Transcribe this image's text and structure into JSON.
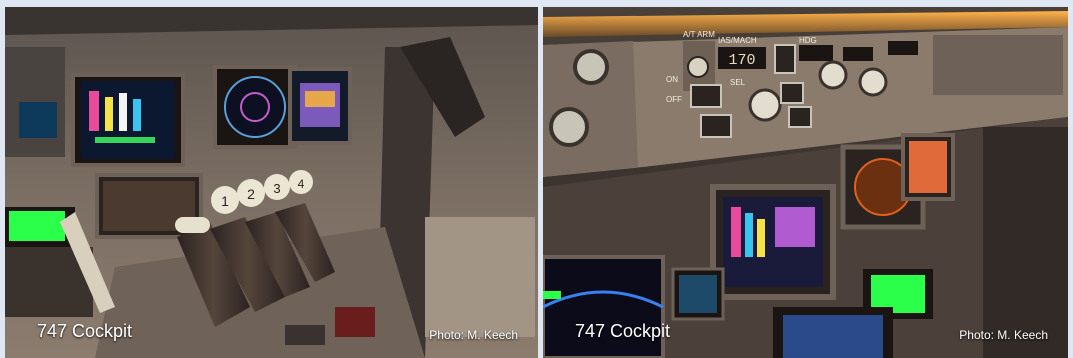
{
  "photos": [
    {
      "title": "747 Cockpit",
      "credit": "Photo: M. Keech"
    },
    {
      "title": "747 Cockpit",
      "credit": "Photo: M. Keech"
    }
  ],
  "lever_numbers": [
    "1",
    "2",
    "3",
    "4"
  ],
  "panel_readout": "170",
  "panel_labels": [
    "A/T ARM",
    "IAS/MACH",
    "HDG",
    "OFF",
    "ON",
    "SEL"
  ],
  "colors": {
    "page_background": "#dfe8f2",
    "caption_text": "#ffffff",
    "screen_green": "#2cff4a",
    "backlight_orange": "#ffb24a"
  }
}
